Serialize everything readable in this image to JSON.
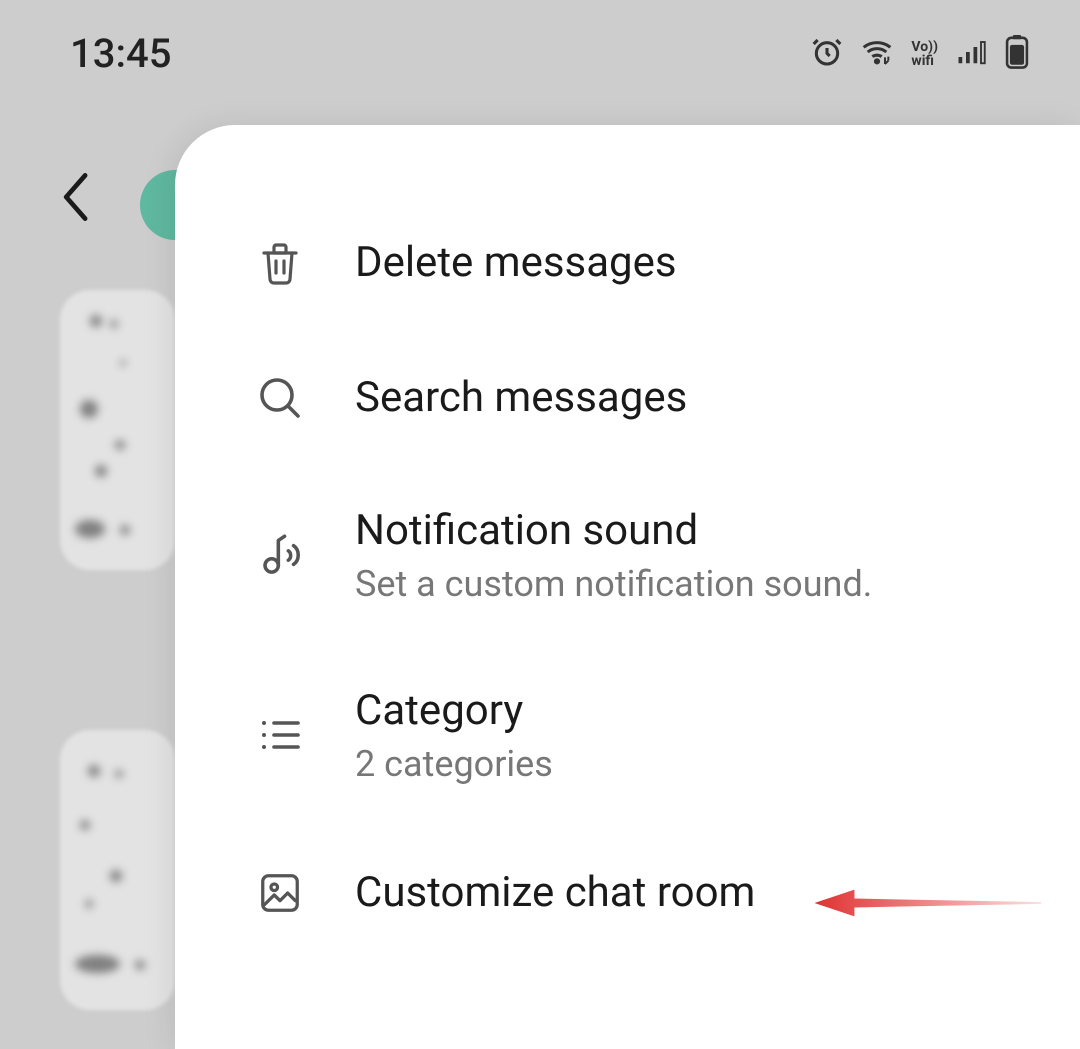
{
  "status_bar": {
    "time": "13:45",
    "icons": {
      "alarm": "alarm-icon",
      "wifi": "wifi-icon",
      "vowifi_top": "Vo))",
      "vowifi_bottom": "wifi",
      "signal": "signal-icon",
      "battery": "battery-icon"
    }
  },
  "menu": {
    "items": [
      {
        "icon": "trash-icon",
        "title": "Delete messages",
        "subtitle": null
      },
      {
        "icon": "search-icon",
        "title": "Search messages",
        "subtitle": null
      },
      {
        "icon": "music-sound-icon",
        "title": "Notification sound",
        "subtitle": "Set a custom notification sound."
      },
      {
        "icon": "list-icon",
        "title": "Category",
        "subtitle": "2 categories"
      },
      {
        "icon": "image-icon",
        "title": "Customize chat room",
        "subtitle": null
      }
    ]
  },
  "annotation": {
    "arrow_color": "#e03131"
  }
}
